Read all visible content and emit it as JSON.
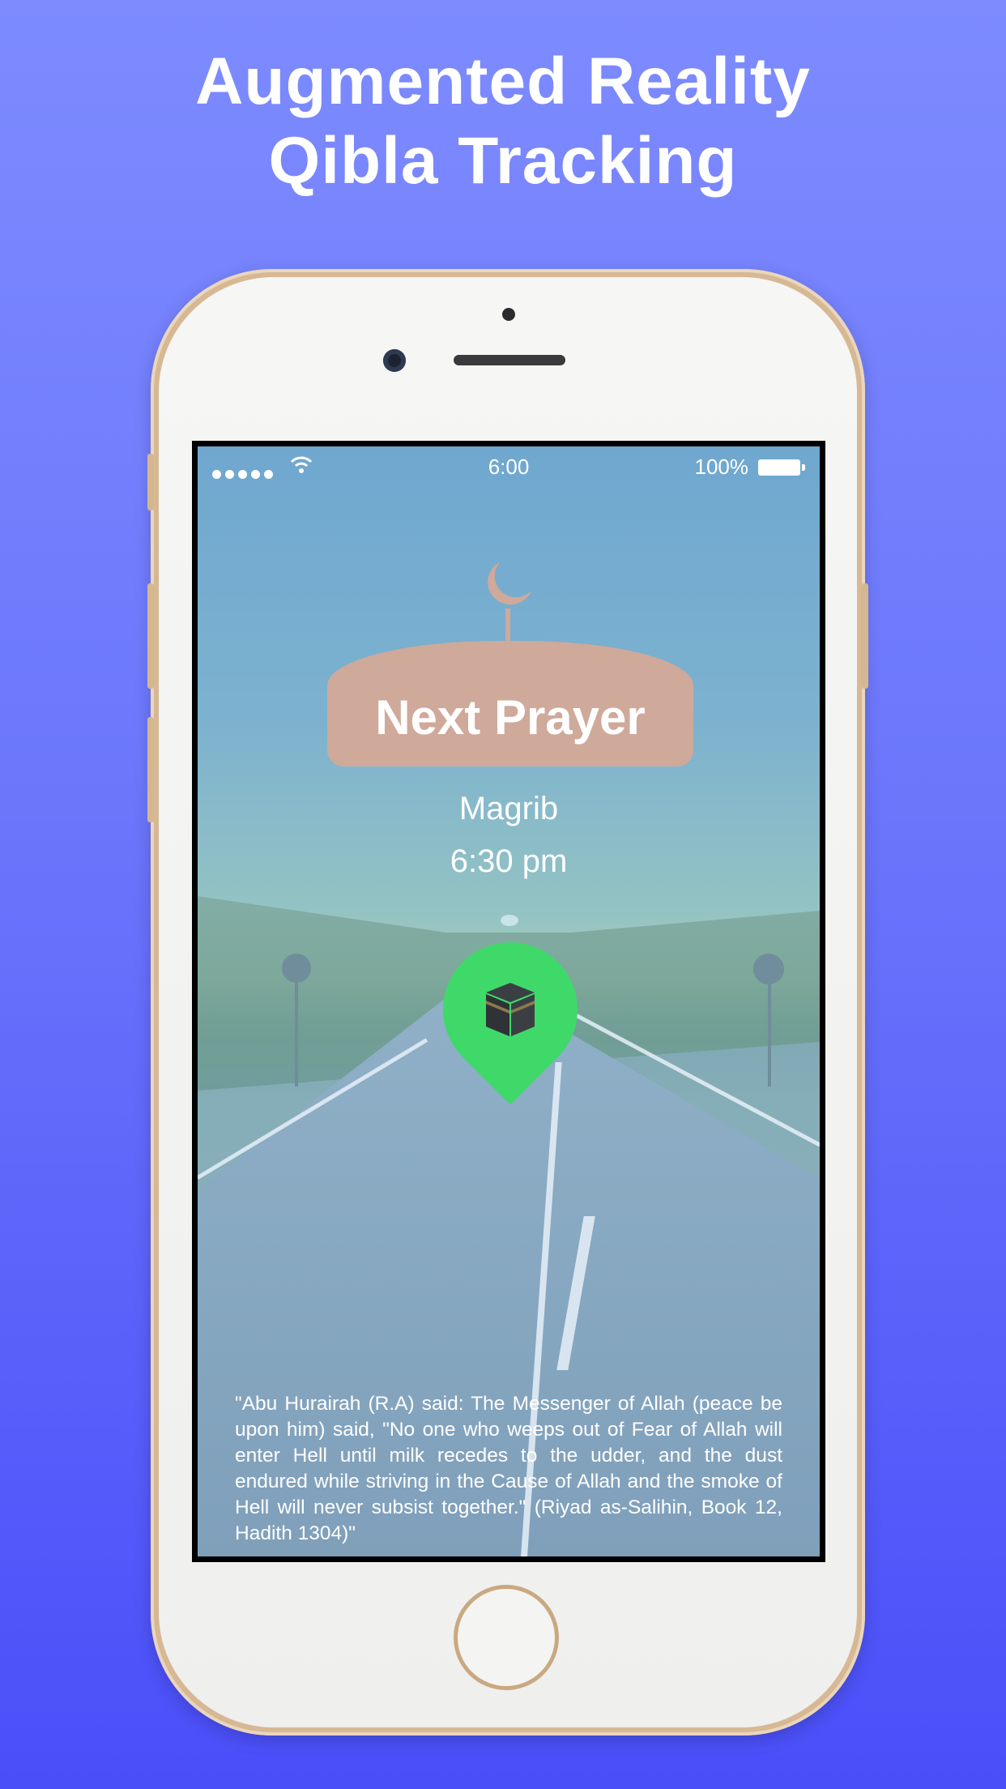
{
  "headline": {
    "line1": "Augmented Reality",
    "line2": "Qibla Tracking"
  },
  "status_bar": {
    "time": "6:00",
    "battery_percent": "100%",
    "signal_icon": "signal-dots-icon",
    "wifi_icon": "wifi-icon",
    "battery_icon": "battery-icon"
  },
  "prayer": {
    "banner_label": "Next Prayer",
    "name": "Magrib",
    "time": "6:30 pm"
  },
  "qibla_marker": {
    "icon": "kaaba-icon",
    "color": "#3fd96a"
  },
  "hadith": {
    "text": "\"Abu Hurairah (R.A) said: The Messenger of Allah (peace be upon him) said, \"No one who weeps out of Fear of Allah will enter Hell until milk recedes to the udder, and the dust endured while striving in the Cause of Allah and the smoke of Hell will never subsist together.\" (Riyad as-Salihin, Book 12, Hadith 1304)\""
  },
  "colors": {
    "background_top": "#7d8bff",
    "background_bottom": "#4a4ef9",
    "banner": "#cfa99a",
    "phone_frame": "#d7b894"
  }
}
